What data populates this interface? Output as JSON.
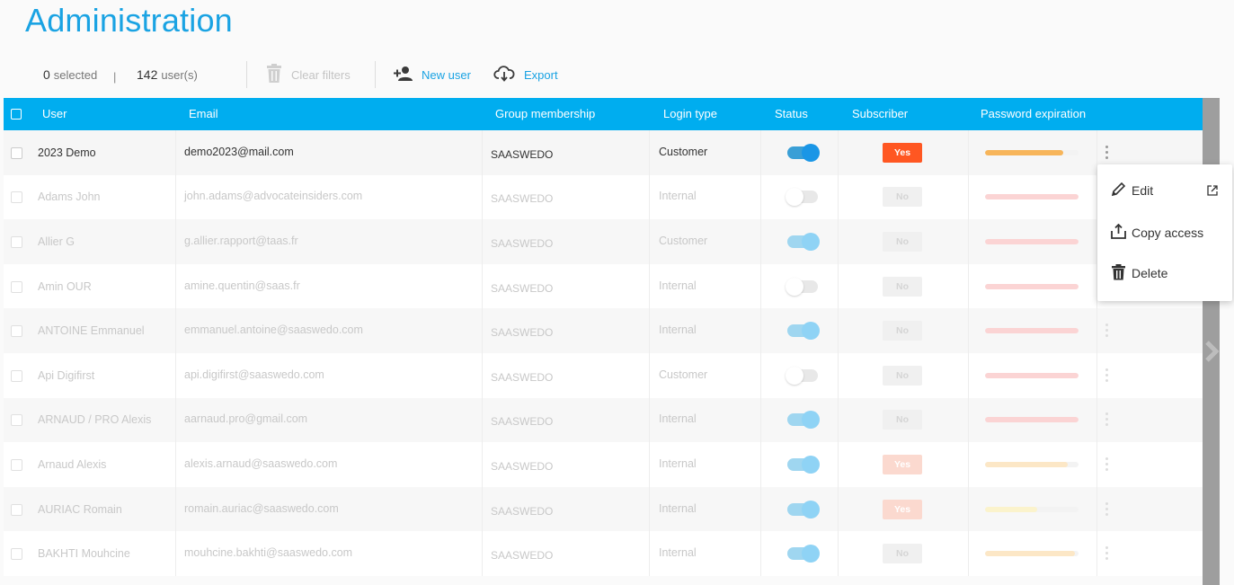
{
  "page": {
    "title": "Administration"
  },
  "toolbar": {
    "selected_count": "0",
    "selected_label": "selected",
    "separator": "|",
    "user_count": "142",
    "user_label": "user(s)",
    "clear_filters": "Clear filters",
    "new_user": "New user",
    "export": "Export"
  },
  "table": {
    "headers": {
      "user": "User",
      "email": "Email",
      "group": "Group membership",
      "login": "Login type",
      "status": "Status",
      "subscriber": "Subscriber",
      "password": "Password expiration"
    },
    "rows": [
      {
        "user": "2023 Demo",
        "email": "demo2023@mail.com",
        "group": "SAASWEDO",
        "login": "Customer",
        "status": "on",
        "subscriber": "Yes",
        "password_fill": 0.84,
        "password_color": "#f7b55a"
      },
      {
        "user": "Adams John",
        "email": "john.adams@advocateinsiders.com",
        "group": "SAASWEDO",
        "login": "Internal",
        "status": "off",
        "subscriber": "No",
        "password_fill": 1.0,
        "password_color": "#fbd4d4"
      },
      {
        "user": "Allier G",
        "email": "g.allier.rapport@taas.fr",
        "group": "SAASWEDO",
        "login": "Customer",
        "status": "on",
        "subscriber": "No",
        "password_fill": 1.0,
        "password_color": "#fbd4d4"
      },
      {
        "user": "Amin OUR",
        "email": "amine.quentin@saas.fr",
        "group": "SAASWEDO",
        "login": "Internal",
        "status": "off",
        "subscriber": "No",
        "password_fill": 1.0,
        "password_color": "#fbd4d4"
      },
      {
        "user": "ANTOINE Emmanuel",
        "email": "emmanuel.antoine@saaswedo.com",
        "group": "SAASWEDO",
        "login": "Internal",
        "status": "on",
        "subscriber": "No",
        "password_fill": 1.0,
        "password_color": "#fbd4d4"
      },
      {
        "user": "Api Digifirst",
        "email": "api.digifirst@saaswedo.com",
        "group": "SAASWEDO",
        "login": "Customer",
        "status": "off",
        "subscriber": "No",
        "password_fill": 1.0,
        "password_color": "#fbd4d4"
      },
      {
        "user": "ARNAUD / PRO Alexis",
        "email": "aarnaud.pro@gmail.com",
        "group": "SAASWEDO",
        "login": "Internal",
        "status": "on",
        "subscriber": "No",
        "password_fill": 1.0,
        "password_color": "#fbd4d4"
      },
      {
        "user": "Arnaud Alexis",
        "email": "alexis.arnaud@saaswedo.com",
        "group": "SAASWEDO",
        "login": "Internal",
        "status": "on",
        "subscriber": "Yes",
        "password_fill": 0.88,
        "password_color": "#fce7c6"
      },
      {
        "user": "AURIAC Romain",
        "email": "romain.auriac@saaswedo.com",
        "group": "SAASWEDO",
        "login": "Internal",
        "status": "on",
        "subscriber": "Yes",
        "password_fill": 0.56,
        "password_color": "#fbf3cc"
      },
      {
        "user": "BAKHTI Mouhcine",
        "email": "mouhcine.bakhti@saaswedo.com",
        "group": "SAASWEDO",
        "login": "Internal",
        "status": "on",
        "subscriber": "No",
        "password_fill": 0.96,
        "password_color": "#fce7c6"
      }
    ]
  },
  "context_menu": {
    "edit": "Edit",
    "copy_access": "Copy access",
    "delete": "Delete"
  },
  "colors": {
    "accent": "#00adef",
    "title": "#1aa3e3",
    "yes_badge": "#ff5722",
    "toggle_on": "#1a96e6"
  },
  "icons": {
    "clear_filters": "trash-icon",
    "new_user": "add-user-icon",
    "export": "cloud-download-icon",
    "edit": "pencil-icon",
    "open_external": "external-link-icon",
    "copy_access": "upload-tray-icon",
    "delete": "trash-icon",
    "row_menu": "kebab-icon",
    "scroll": "chevron-right-icon"
  }
}
